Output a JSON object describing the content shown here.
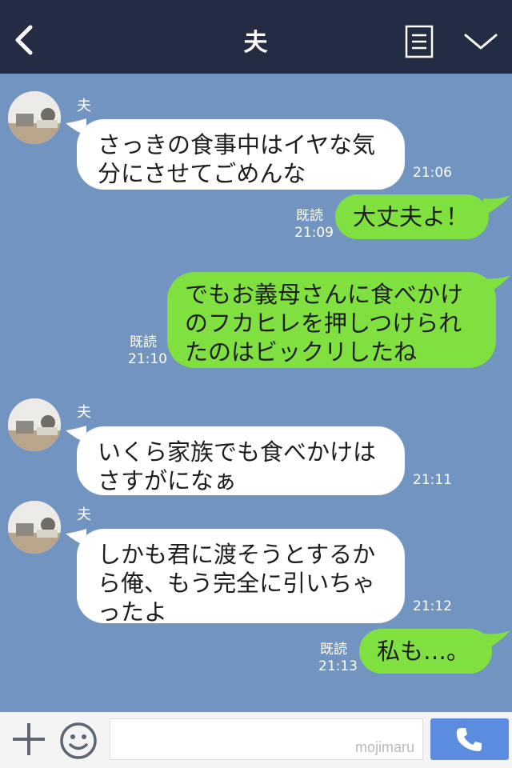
{
  "header": {
    "title": "夫",
    "icons": {
      "back": "back-chevron-icon",
      "menu": "menu-icon",
      "more": "chevron-down-icon"
    }
  },
  "messages": [
    {
      "direction": "in",
      "sender": "夫",
      "lines": [
        "さっきの食事中はイヤな気",
        "分にさせてごめんな"
      ],
      "time": "21:06"
    },
    {
      "direction": "out",
      "lines": [
        "大丈夫よ！"
      ],
      "read": "既読",
      "time": "21:09"
    },
    {
      "direction": "out",
      "lines": [
        "でもお義母さんに食べかけ",
        "のフカヒレを押しつけられ",
        "たのはビックリしたね"
      ],
      "read": "既読",
      "time": "21:10"
    },
    {
      "direction": "in",
      "sender": "夫",
      "lines": [
        "いくら家族でも食べかけは",
        "さすがになぁ"
      ],
      "time": "21:11"
    },
    {
      "direction": "in",
      "sender": "夫",
      "lines": [
        "しかも君に渡そうとするか",
        "ら俺、もう完全に引いちゃ",
        "ったよ"
      ],
      "time": "21:12"
    },
    {
      "direction": "out",
      "lines": [
        "私も…。"
      ],
      "read": "既読",
      "time": "21:13"
    }
  ],
  "footer": {
    "input_value": "",
    "watermark": "mojimaru",
    "icons": {
      "add": "plus-icon",
      "emoji": "smiley-icon",
      "call": "phone-icon"
    }
  },
  "colors": {
    "header_bg": "#232c43",
    "chat_bg": "#7194c1",
    "incoming_bubble": "#ffffff",
    "outgoing_bubble": "#80e040",
    "call_button": "#5b8ce0"
  }
}
